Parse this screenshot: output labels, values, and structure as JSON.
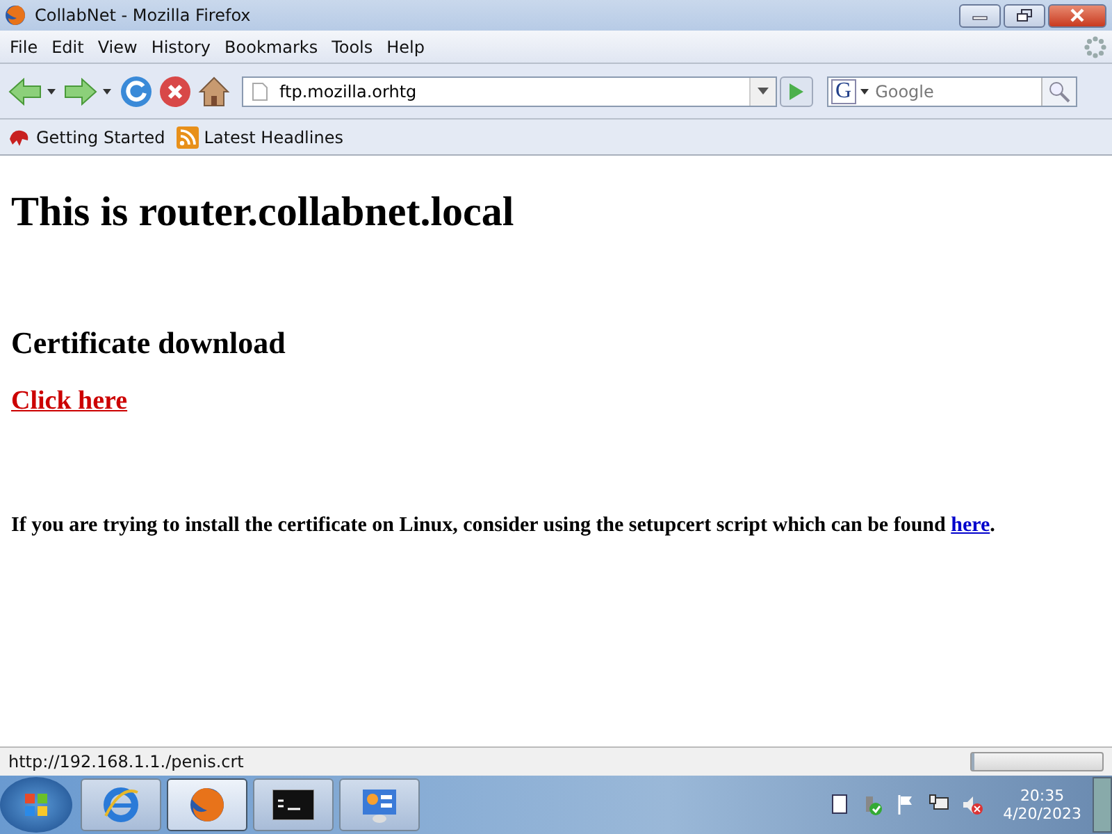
{
  "window": {
    "title": "CollabNet - Mozilla Firefox"
  },
  "menu": [
    "File",
    "Edit",
    "View",
    "History",
    "Bookmarks",
    "Tools",
    "Help"
  ],
  "address_bar": {
    "value": "ftp.mozilla.orhtg"
  },
  "search": {
    "engine": "G",
    "placeholder": "Google"
  },
  "bookmarks": [
    {
      "kind": "page",
      "label": "Getting Started"
    },
    {
      "kind": "feed",
      "label": "Latest Headlines"
    }
  ],
  "page": {
    "heading": "This is router.collabnet.local",
    "subheading": "Certificate download",
    "download_link": "Click here",
    "note": "If you are trying to install the certificate on Linux, consider using the setupcert script which can be found ",
    "note_link": "here",
    "note_end": "."
  },
  "status_bar": {
    "text": "http://192.168.1.1./penis.crt",
    "progress": {
      "level": 0
    }
  },
  "taskbar": {
    "apps": [
      {
        "kind": "browser-e",
        "selected": false
      },
      {
        "kind": "firefox",
        "selected": true
      },
      {
        "kind": "terminal",
        "selected": false
      },
      {
        "kind": "panel",
        "selected": false
      }
    ],
    "time": "20:35",
    "date": "4/20/2023"
  }
}
